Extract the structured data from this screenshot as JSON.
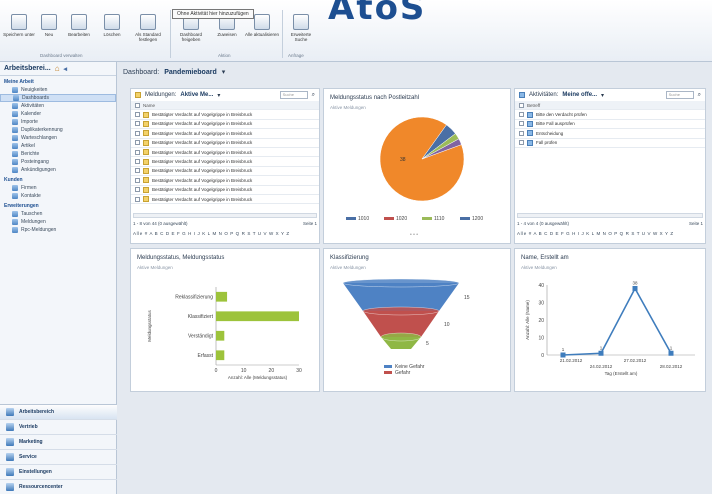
{
  "app": {
    "logo": "AtoS",
    "tooltip": "Ohne Aktivität hier hinzuzufügen"
  },
  "ribbon": {
    "buttons": [
      "Speichern unter",
      "Neu",
      "Bearbeiten",
      "Löschen",
      "Als Standard festlegen",
      "Dashboard freigeben",
      "Zuweisen",
      "Alle aktualisieren",
      "Erweiterte Suche"
    ],
    "groups": [
      "Dashboard verwalten",
      "Aktion",
      "Anfrage"
    ]
  },
  "nav": {
    "header": "Arbeitsberei...",
    "my_work": "Meine Arbeit",
    "my_work_items": [
      "Neuigkeiten",
      "Dashboards",
      "Aktivitäten",
      "Kalender",
      "Importe",
      "Duplikaterkennung",
      "Warteschlangen",
      "Artikel",
      "Berichte",
      "Posteingang",
      "Ankündigungen"
    ],
    "customers": "Kunden",
    "customers_items": [
      "Firmen",
      "Kontakte"
    ],
    "extensions": "Erweiterungen",
    "extensions_items": [
      "Tauschen",
      "Meldungen",
      "Rpc-Meldungen"
    ],
    "workspaces": [
      "Arbeitsbereich",
      "Vertrieb",
      "Marketing",
      "Service",
      "Einstellungen",
      "Ressourcencenter"
    ]
  },
  "dashboard": {
    "label": "Dashboard:",
    "name": "Pandemieboard",
    "chevron": "▾"
  },
  "grid1": {
    "label": "Meldungen:",
    "view": "Aktive Me...",
    "search_placeholder": "Suche",
    "column": "Name",
    "rows": [
      "Bestätigter Verdacht auf Vogelgrippe in Breisbruck",
      "Bestätigter Verdacht auf Vogelgrippe in Breisbruck",
      "Bestätigter Verdacht auf Vogelgrippe in Breisbruck",
      "Bestätigter Verdacht auf Vogelgrippe in Breisbruck",
      "Bestätigter Verdacht auf Vogelgrippe in Breisbruck",
      "Bestätigter Verdacht auf Vogelgrippe in Breisbruck",
      "Bestätigter Verdacht auf Vogelgrippe in Breisbruck",
      "Bestätigter Verdacht auf Vogelgrippe in Breisbruck",
      "Bestätigter Verdacht auf Vogelgrippe in Breisbruck",
      "Bestätigter Verdacht auf Vogelgrippe in Breisbruck"
    ],
    "pager": "1 - 8 von 44 (0 ausgewählt)",
    "page": "Seite 1",
    "alphabet": "Alle # A B C D E F G H I J K L M N O P Q R S T U V W X Y Z"
  },
  "grid2": {
    "label": "Aktivitäten:",
    "view": "Meine offe...",
    "search_placeholder": "Suche",
    "column": "Betreff",
    "rows": [
      "Bitte den Verdacht prüfen",
      "Bitte Fall ausprüfen",
      "Entscheidung",
      "Fall prüfen"
    ],
    "pager": "1 - 4 von 4 (0 ausgewählt)",
    "page": "Seite 1",
    "alphabet": "Alle # A B C D E F G H I J K L M N O P Q R S T U V W X Y Z"
  },
  "pie_panel": {
    "title": "Meldungsstatus nach Postleitzahl",
    "subtitle": "Aktive Meldungen",
    "dots": "• • •"
  },
  "bar_panel": {
    "title": "Meldungsstatus, Meldungsstatus",
    "subtitle": "Aktive Meldungen"
  },
  "funnel_panel": {
    "title": "Klassifizierung",
    "subtitle": "Aktive Meldungen"
  },
  "line_panel": {
    "title": "Name, Erstellt am",
    "subtitle": "Aktive Meldungen"
  },
  "colors": {
    "pie_main": "#f0882a",
    "pie_blue": "#4a6fa5",
    "bar_green": "#9dc33b",
    "funnel_blue": "#4e82c4",
    "funnel_red": "#c0504d",
    "funnel_green": "#8fb745",
    "line": "#3f7dbd"
  },
  "chart_data": [
    {
      "type": "pie",
      "title": "Meldungsstatus nach Postleitzahl",
      "categories": [
        "1010",
        "1020",
        "1110",
        "1200"
      ],
      "values": [
        38,
        2,
        1,
        1
      ],
      "data_label": "38"
    },
    {
      "type": "bar",
      "title": "Meldungsstatus, Meldungsstatus",
      "categories": [
        "Reklassifizierung",
        "Klassifiziert",
        "Verständigt",
        "Erfasst"
      ],
      "values": [
        4,
        31,
        3,
        3
      ],
      "xlabel": "Anzahl: Alle (Meldungsstatus)",
      "ylabel": "Meldungsstatus",
      "xlim": [
        0,
        30
      ],
      "ticks": [
        "0",
        "10",
        "20",
        "30"
      ]
    },
    {
      "type": "funnel",
      "title": "Klassifizierung",
      "categories": [
        "Keine Gefahr",
        "Gefahr"
      ],
      "values": [
        15,
        10,
        5
      ],
      "data_labels": [
        "15",
        "10",
        "5"
      ]
    },
    {
      "type": "line",
      "title": "Name, Erstellt am",
      "x": [
        "21.02.2012",
        "24.02.2012",
        "27.02.2012",
        "28.02.2012"
      ],
      "values": [
        0,
        1,
        38,
        1
      ],
      "point_labels": [
        "1",
        "1",
        "38",
        "1"
      ],
      "xlabel": "Tag (Erstellt am)",
      "ylabel": "Anzahl: Alle (Name)",
      "ylim": [
        0,
        40
      ],
      "yticks": [
        "0",
        "10",
        "20",
        "30",
        "40"
      ]
    }
  ]
}
